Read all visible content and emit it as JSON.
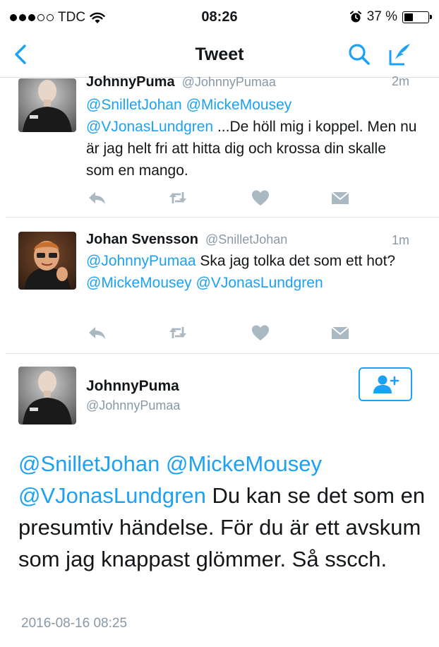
{
  "status_bar": {
    "carrier": "TDC",
    "time": "08:26",
    "battery": "37 %",
    "battery_level": 0.37
  },
  "nav": {
    "title": "Tweet"
  },
  "tweets": [
    {
      "name": "JohnnyPuma",
      "handle": "@JohnnyPumaa",
      "time": "2m",
      "mentions": [
        "@SnilletJohan",
        "@MickeMousey",
        "@VJonasLundgren"
      ],
      "text": "...De höll mig i koppel. Men nu är jag helt fri att hitta dig och krossa din skalle som en mango."
    },
    {
      "name": "Johan Svensson",
      "handle": "@SnilletJohan",
      "time": "1m",
      "mentions": [
        "@JohnnyPumaa",
        "@MickeMousey",
        "@VJonasLundgren"
      ],
      "text_a": "Ska jag tolka det som ett hot?"
    }
  ],
  "main_tweet": {
    "name": "JohnnyPuma",
    "handle": "@JohnnyPumaa",
    "mentions": [
      "@SnilletJohan",
      "@MickeMousey",
      "@VJonasLundgren"
    ],
    "text": "Du kan se det som en presumtiv händelse. För du är ett avskum som jag knappast glömmer. Så sscch.",
    "timestamp": "2016-08-16 08:25"
  },
  "colors": {
    "accent": "#1da1f2",
    "muted": "#8899a6",
    "icon_gray": "#aab8c2"
  }
}
